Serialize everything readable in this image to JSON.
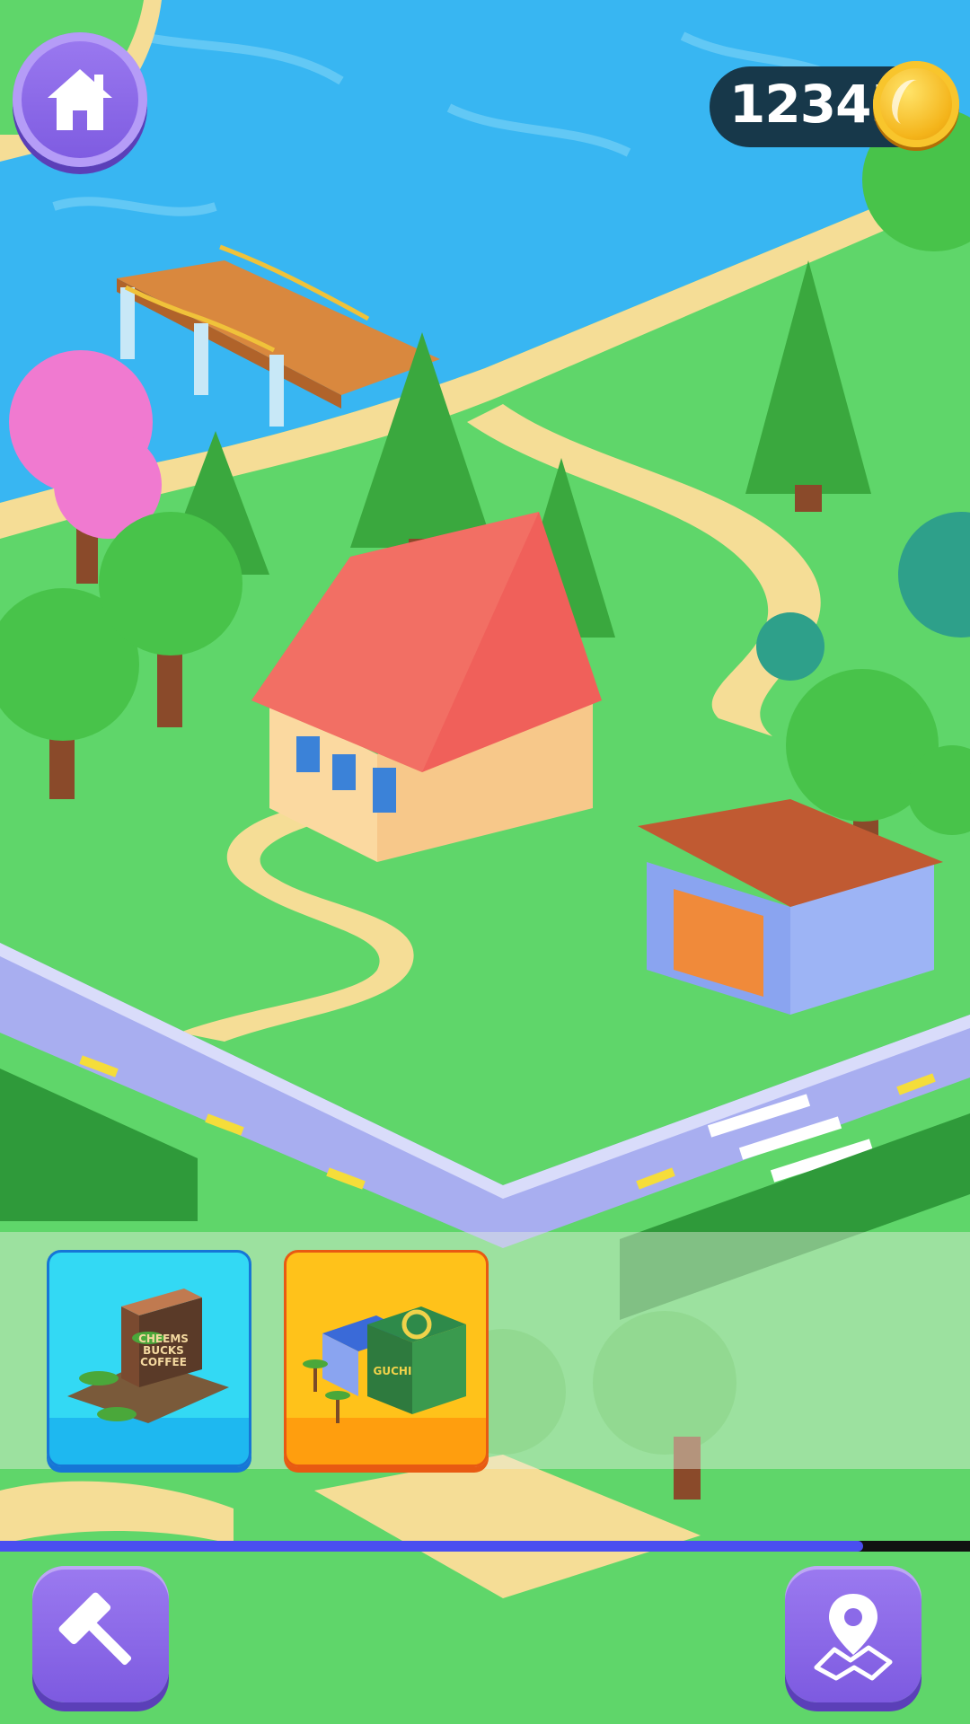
{
  "hud": {
    "coins": "12345",
    "icons": [
      "home-icon",
      "coin-icon",
      "hammer-icon",
      "map-pin-icon"
    ]
  },
  "build_cards": [
    {
      "id": "coffee",
      "label": "CHEEMS BUCKS COFFEE",
      "color": "#33d9f4"
    },
    {
      "id": "shop",
      "label": "GUCHI",
      "color": "#ffc21a"
    }
  ],
  "progress": {
    "fraction": 0.89,
    "color": "#4a4ef0"
  },
  "colors": {
    "grass": "#5fd66a",
    "water": "#38b6f2",
    "path": "#f5dd96",
    "road": "#a8aef0",
    "roof": "#f0605a",
    "accent": "#8b6ae8"
  }
}
